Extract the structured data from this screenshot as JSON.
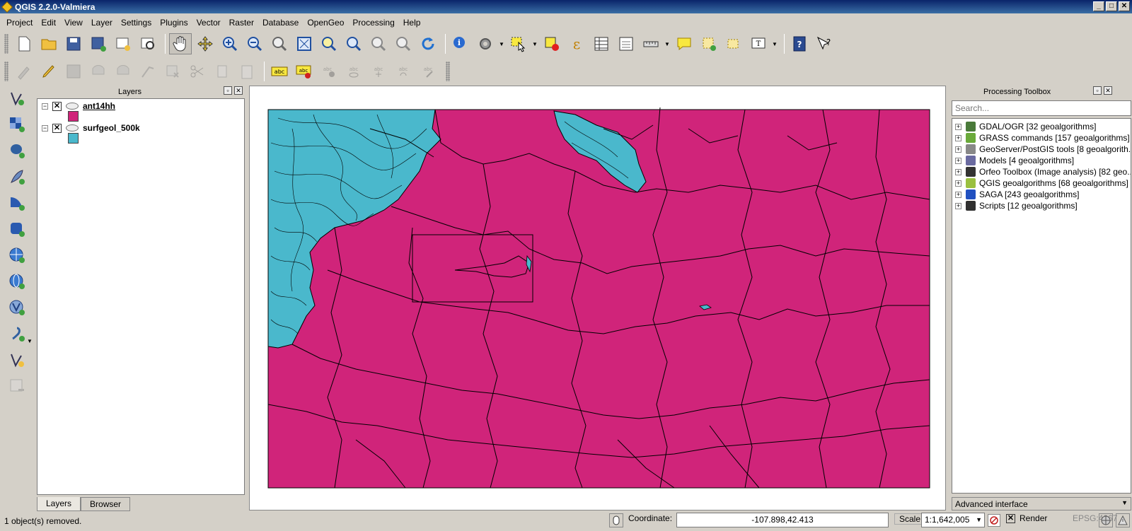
{
  "window": {
    "title": "QGIS 2.2.0-Valmiera",
    "minimize": "_",
    "maximize": "□",
    "close": "✕"
  },
  "menu": [
    "Project",
    "Edit",
    "View",
    "Layer",
    "Settings",
    "Plugins",
    "Vector",
    "Raster",
    "Database",
    "OpenGeo",
    "Processing",
    "Help"
  ],
  "layers_panel": {
    "title": "Layers",
    "layers": [
      {
        "name": "ant14hh",
        "color": "#d0247a",
        "checked": "✕",
        "expand": "−"
      },
      {
        "name": "surfgeol_500k",
        "color": "#4ab8cc",
        "checked": "✕",
        "expand": "−"
      }
    ],
    "tabs": [
      "Layers",
      "Browser"
    ]
  },
  "toolbox": {
    "title": "Processing Toolbox",
    "search_placeholder": "Search...",
    "items": [
      {
        "label": "GDAL/OGR [32 geoalgorithms]",
        "icon": "gdal-icon",
        "color": "#4a7a3a"
      },
      {
        "label": "GRASS commands [157 geoalgorithms]",
        "icon": "grass-icon",
        "color": "#6aaa3a"
      },
      {
        "label": "GeoServer/PostGIS tools [8 geoalgorith...",
        "icon": "database-icon",
        "color": "#888888"
      },
      {
        "label": "Models [4 geoalgorithms]",
        "icon": "models-icon",
        "color": "#6a6aa0"
      },
      {
        "label": "Orfeo Toolbox (Image analysis) [82 geo...",
        "icon": "orfeo-icon",
        "color": "#333333"
      },
      {
        "label": "QGIS geoalgorithms [68 geoalgorithms]",
        "icon": "qgis-icon",
        "color": "#9ac040"
      },
      {
        "label": "SAGA [243 geoalgorithms]",
        "icon": "saga-icon",
        "color": "#2050c0"
      },
      {
        "label": "Scripts [12 geoalgorithms]",
        "icon": "scripts-icon",
        "color": "#303030"
      }
    ],
    "expand": "+",
    "advanced": "Advanced interface"
  },
  "status": {
    "message": "1 object(s) removed.",
    "coordinate_label": "Coordinate:",
    "coordinate": "-107.898,42.413",
    "scale_label": "Scale",
    "scale": "1:1,642,005",
    "render_label": "Render",
    "render_check": "✕",
    "epsg": "EPSG:4267"
  },
  "colors": {
    "fill_magenta": "#d0247a",
    "fill_cyan": "#4ab8cc"
  }
}
